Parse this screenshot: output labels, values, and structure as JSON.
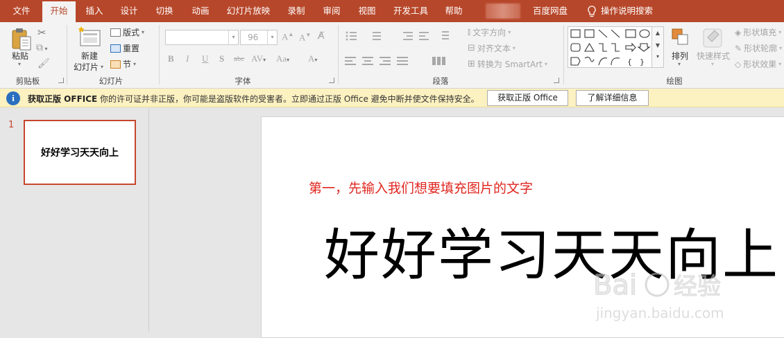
{
  "tabs": [
    {
      "label": "文件"
    },
    {
      "label": "开始"
    },
    {
      "label": "插入"
    },
    {
      "label": "设计"
    },
    {
      "label": "切换"
    },
    {
      "label": "动画"
    },
    {
      "label": "幻灯片放映"
    },
    {
      "label": "录制"
    },
    {
      "label": "审阅"
    },
    {
      "label": "视图"
    },
    {
      "label": "开发工具"
    },
    {
      "label": "帮助"
    },
    {
      "label": "百度网盘"
    },
    {
      "label": "操作说明搜索"
    }
  ],
  "active_tab": "开始",
  "ribbon": {
    "clipboard": {
      "paste": "粘贴",
      "label": "剪贴板"
    },
    "slides": {
      "new_slide_1": "新建",
      "new_slide_2": "幻灯片",
      "layout": "版式",
      "reset": "重置",
      "section": "节",
      "label": "幻灯片"
    },
    "font": {
      "size": "96",
      "label": "字体"
    },
    "paragraph": {
      "text_direction": "文字方向",
      "align_text": "对齐文本",
      "smartart": "转换为 SmartArt",
      "label": "段落"
    },
    "drawing": {
      "arrange": "排列",
      "quick_styles": "快速样式",
      "shape_fill": "形状填充",
      "shape_outline": "形状轮廓",
      "shape_effects": "形状效果",
      "label": "绘图"
    }
  },
  "notification": {
    "title": "获取正版 OFFICE",
    "message": "你的许可证并非正版，你可能是盗版软件的受害者。立即通过正版 Office 避免中断并使文件保持安全。",
    "btn_get": "获取正版 Office",
    "btn_learn": "了解详细信息"
  },
  "thumbnails": [
    {
      "number": "1",
      "text": "好好学习天天向上"
    }
  ],
  "slide": {
    "caption": "第一，先输入我们想要填充图片的文字",
    "main_text": "好好学习天天向上"
  },
  "watermark": {
    "line1": "Bai",
    "line2": "经验",
    "url": "jingyan.baidu.com"
  },
  "colors": {
    "accent": "#b7472a",
    "caption": "#e0261f",
    "info": "#2a6fbf",
    "notify_bg": "#fcf1c0"
  }
}
